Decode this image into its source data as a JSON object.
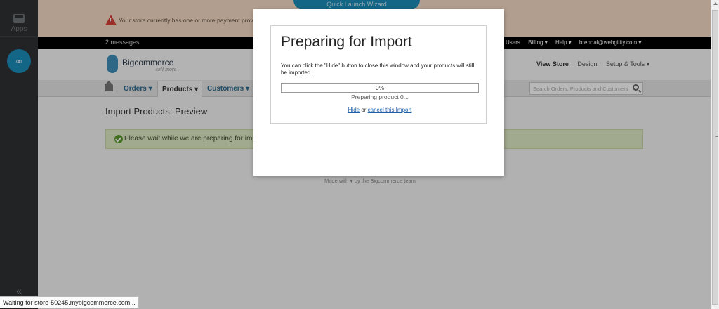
{
  "rail": {
    "apps_label": "Apps",
    "collapse_glyph": "«",
    "app_mark": "∞"
  },
  "alert": {
    "text": "Your store currently has one or more payment provid",
    "wizard_label": "Quick Launch Wizard"
  },
  "topbar": {
    "messages": "2 messages",
    "links": [
      "Users",
      "Billing ▾",
      "Help ▾",
      "brendal@webgility.com ▾"
    ]
  },
  "brand": {
    "name": "Bigcommerce",
    "tagline": "sell more",
    "view_store": "View Store",
    "design": "Design",
    "setup_tools": "Setup & Tools ▾"
  },
  "nav": {
    "orders": "Orders ▾",
    "products": "Products ▾",
    "customers": "Customers ▾",
    "search_placeholder": "Search Orders, Products and Customers"
  },
  "main": {
    "title": "Import Products: Preview",
    "notice": "Please wait while we are preparing for impo",
    "footer": "Made with ♥ by the Bigcommerce team"
  },
  "modal": {
    "title": "Preparing for Import",
    "description": "You can click the \"Hide\" button to close this window and your products will still be imported.",
    "progress": 0,
    "progress_label": "0%",
    "status": "Preparing product 0...",
    "hide_link": "Hide",
    "or_text": " or ",
    "cancel_link": "cancel this Import"
  },
  "statusbar": {
    "text": "Waiting for store-50245.mybigcommerce.com..."
  },
  "colors": {
    "accent": "#1b8eb9",
    "alert_bg": "#f7dcc5",
    "notice_bg": "#dfeac5"
  }
}
